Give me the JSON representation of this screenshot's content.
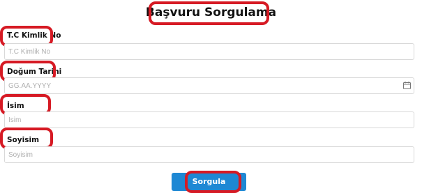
{
  "page": {
    "title": "Başvuru Sorgulama"
  },
  "form": {
    "tc": {
      "label": "T.C Kimlik No",
      "placeholder": "T.C Kimlik No",
      "value": ""
    },
    "dob": {
      "label": "Doğum Tarihi",
      "placeholder": "GG.AA.YYYY",
      "value": "",
      "icon": "calendar-icon"
    },
    "name": {
      "label": "İsim",
      "placeholder": "İsim",
      "value": ""
    },
    "surname": {
      "label": "Soyisim",
      "placeholder": "Soyisim",
      "value": ""
    },
    "submit_label": "Sorgula"
  },
  "colors": {
    "highlight": "#d61a24",
    "button": "#1e88d4",
    "field_border": "#d9d9d9",
    "placeholder": "#b0b0b0"
  }
}
